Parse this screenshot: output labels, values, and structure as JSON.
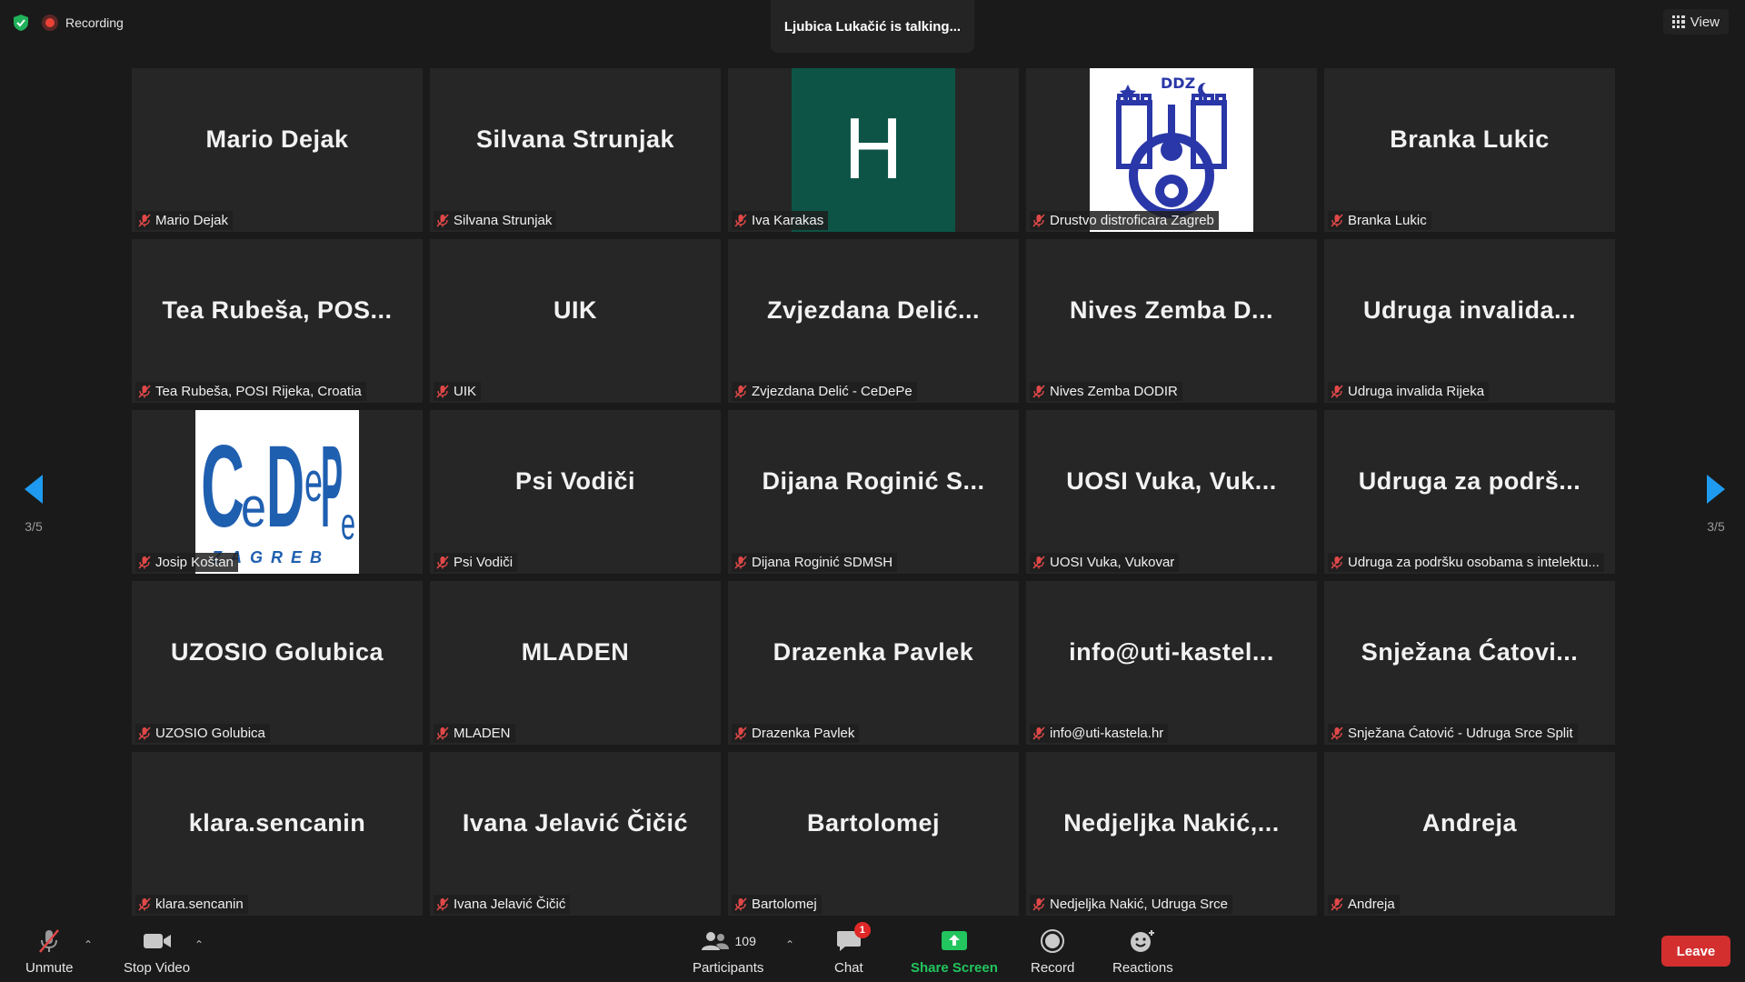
{
  "top": {
    "recording_label": "Recording",
    "talking_banner": "Ljubica Lukačić is talking...",
    "view_label": "View"
  },
  "nav": {
    "page_indicator_left": "3/5",
    "page_indicator_right": "3/5"
  },
  "tiles": [
    {
      "display": "Mario Dejak",
      "label": "Mario Dejak"
    },
    {
      "display": "Silvana Strunjak",
      "label": "Silvana Strunjak"
    },
    {
      "display": "H",
      "label": "Iva Karakas"
    },
    {
      "display": "DDZ",
      "label": "Drustvo distroficara Zagreb"
    },
    {
      "display": "Branka Lukic",
      "label": "Branka Lukic"
    },
    {
      "display": "Tea Rubeša, POS...",
      "label": "Tea Rubeša, POSI Rijeka, Croatia"
    },
    {
      "display": "UIK",
      "label": "UIK"
    },
    {
      "display": "Zvjezdana Delić...",
      "label": "Zvjezdana Delić - CeDePe"
    },
    {
      "display": "Nives Zemba D...",
      "label": "Nives Zemba DODIR"
    },
    {
      "display": "Udruga invalida...",
      "label": "Udruga invalida Rijeka"
    },
    {
      "display": "CeDePe ZAGREB",
      "label": "Josip Koštan"
    },
    {
      "display": "Psi Vodiči",
      "label": "Psi Vodiči"
    },
    {
      "display": "Dijana Roginić S...",
      "label": "Dijana Roginić SDMSH"
    },
    {
      "display": "UOSI Vuka, Vuk...",
      "label": "UOSI Vuka, Vukovar"
    },
    {
      "display": "Udruga za podrš...",
      "label": "Udruga za podršku osobama s intelektu..."
    },
    {
      "display": "UZOSIO Golubica",
      "label": "UZOSIO Golubica"
    },
    {
      "display": "MLADEN",
      "label": "MLADEN"
    },
    {
      "display": "Drazenka Pavlek",
      "label": "Drazenka Pavlek"
    },
    {
      "display": "info@uti-kastel...",
      "label": "info@uti-kastela.hr"
    },
    {
      "display": "Snježana Ćatovi...",
      "label": "Snježana Ćatović - Udruga Srce Split"
    },
    {
      "display": "klara.sencanin",
      "label": "klara.sencanin"
    },
    {
      "display": "Ivana Jelavić Čičić",
      "label": "Ivana Jelavić Čičić"
    },
    {
      "display": "Bartolomej",
      "label": "Bartolomej"
    },
    {
      "display": "Nedjeljka Nakić,...",
      "label": "Nedjeljka Nakić, Udruga Srce"
    },
    {
      "display": "Andreja",
      "label": "Andreja"
    }
  ],
  "toolbar": {
    "unmute": "Unmute",
    "stop_video": "Stop Video",
    "participants": "Participants",
    "participants_count": "109",
    "chat": "Chat",
    "chat_badge": "1",
    "share_screen": "Share Screen",
    "record": "Record",
    "reactions": "Reactions",
    "leave": "Leave"
  },
  "colors": {
    "share": "#22c55e",
    "leave": "#d32f2f",
    "muted_icon": "#e04848",
    "nav_arrow": "#1e9bf0"
  }
}
